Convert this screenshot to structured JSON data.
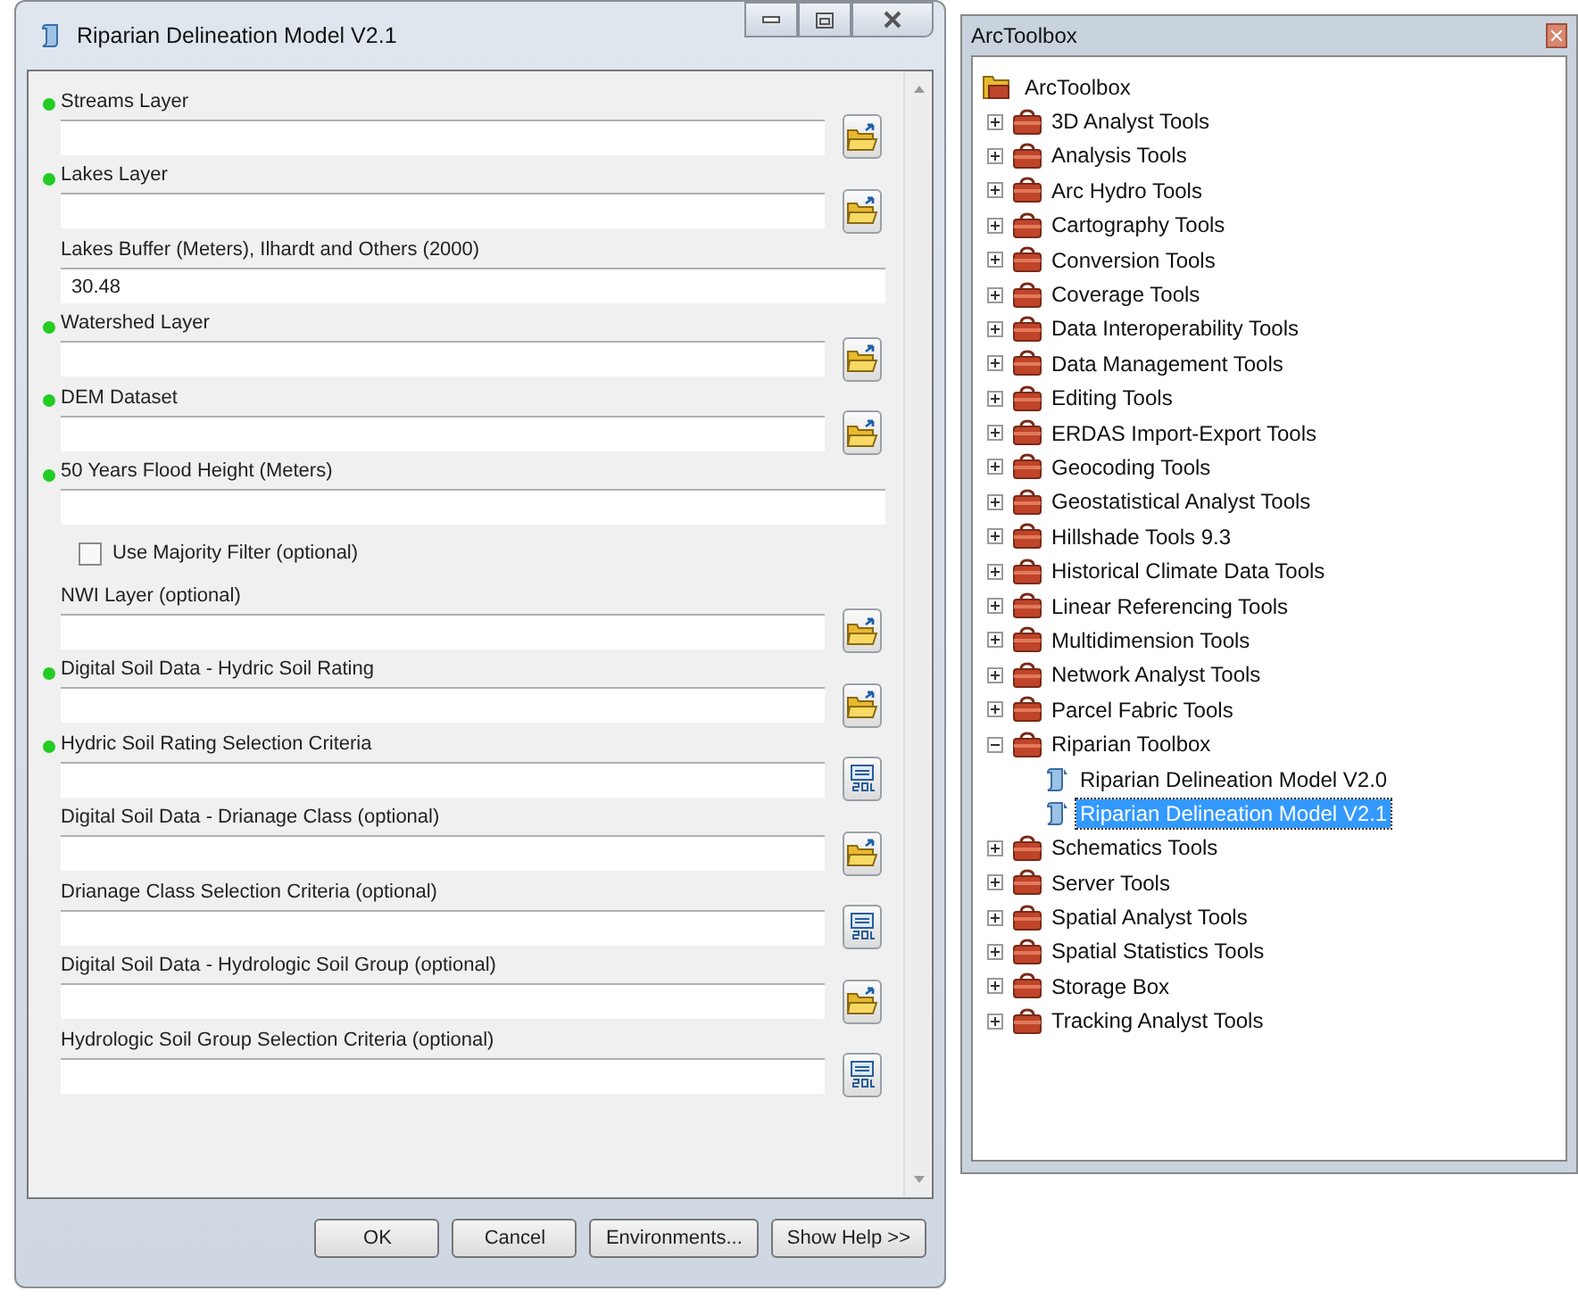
{
  "window": {
    "title": "Riparian Delineation Model V2.1"
  },
  "params": [
    {
      "label": "Streams Layer",
      "required": true,
      "kind": "folder"
    },
    {
      "label": "Lakes Layer",
      "required": true,
      "kind": "folder"
    },
    {
      "label": "Lakes Buffer (Meters), Ilhardt and Others (2000)",
      "required": false,
      "kind": "plain",
      "value": "30.48"
    },
    {
      "label": "Watershed Layer",
      "required": true,
      "kind": "folder"
    },
    {
      "label": "DEM Dataset",
      "required": true,
      "kind": "folder"
    },
    {
      "label": "50 Years Flood Height (Meters)",
      "required": true,
      "kind": "plain"
    },
    {
      "label": "Use Majority Filter (optional)",
      "required": false,
      "kind": "checkbox",
      "checked": false
    },
    {
      "label": "NWI Layer (optional)",
      "required": false,
      "kind": "folder"
    },
    {
      "label": "Digital Soil Data - Hydric Soil Rating",
      "required": true,
      "kind": "folder"
    },
    {
      "label": "Hydric Soil Rating Selection Criteria",
      "required": true,
      "kind": "sql"
    },
    {
      "label": "Digital Soil Data - Drianage Class (optional)",
      "required": false,
      "kind": "folder"
    },
    {
      "label": "Drianage Class Selection Criteria (optional)",
      "required": false,
      "kind": "sql"
    },
    {
      "label": "Digital Soil Data - Hydrologic Soil Group (optional)",
      "required": false,
      "kind": "folder"
    },
    {
      "label": "Hydrologic Soil Group Selection Criteria (optional)",
      "required": false,
      "kind": "sql"
    }
  ],
  "buttons": [
    "OK",
    "Cancel",
    "Environments...",
    "Show Help >>"
  ],
  "toolbox": {
    "title": "ArcToolbox",
    "tree": {
      "label": "ArcToolbox",
      "selected": false,
      "children": [
        {
          "label": "3D Analyst Tools",
          "kind": "toolbox",
          "expanded": false,
          "selected": false
        },
        {
          "label": "Analysis Tools",
          "kind": "toolbox",
          "expanded": false,
          "selected": false
        },
        {
          "label": "Arc Hydro Tools",
          "kind": "toolbox",
          "expanded": false,
          "selected": false
        },
        {
          "label": "Cartography Tools",
          "kind": "toolbox",
          "expanded": false,
          "selected": false
        },
        {
          "label": "Conversion Tools",
          "kind": "toolbox",
          "expanded": false,
          "selected": false
        },
        {
          "label": "Coverage Tools",
          "kind": "toolbox",
          "expanded": false,
          "selected": false
        },
        {
          "label": "Data Interoperability Tools",
          "kind": "toolbox",
          "expanded": false,
          "selected": false
        },
        {
          "label": "Data Management Tools",
          "kind": "toolbox",
          "expanded": false,
          "selected": false
        },
        {
          "label": "Editing Tools",
          "kind": "toolbox",
          "expanded": false,
          "selected": false
        },
        {
          "label": "ERDAS Import-Export Tools",
          "kind": "toolbox",
          "expanded": false,
          "selected": false
        },
        {
          "label": "Geocoding Tools",
          "kind": "toolbox",
          "expanded": false,
          "selected": false
        },
        {
          "label": "Geostatistical Analyst Tools",
          "kind": "toolbox",
          "expanded": false,
          "selected": false
        },
        {
          "label": "Hillshade Tools 9.3",
          "kind": "toolbox",
          "expanded": false,
          "selected": false
        },
        {
          "label": "Historical Climate Data Tools",
          "kind": "toolbox",
          "expanded": false,
          "selected": false
        },
        {
          "label": "Linear Referencing Tools",
          "kind": "toolbox",
          "expanded": false,
          "selected": false
        },
        {
          "label": "Multidimension Tools",
          "kind": "toolbox",
          "expanded": false,
          "selected": false
        },
        {
          "label": "Network Analyst Tools",
          "kind": "toolbox",
          "expanded": false,
          "selected": false
        },
        {
          "label": "Parcel Fabric Tools",
          "kind": "toolbox",
          "expanded": false,
          "selected": false
        },
        {
          "label": "Riparian Toolbox",
          "kind": "toolbox",
          "expanded": true,
          "selected": false,
          "children": [
            {
              "label": "Riparian Delineation Model V2.0",
              "kind": "tool",
              "selected": false
            },
            {
              "label": "Riparian Delineation Model V2.1",
              "kind": "tool",
              "selected": true
            }
          ]
        },
        {
          "label": "Schematics Tools",
          "kind": "toolbox",
          "expanded": false,
          "selected": false
        },
        {
          "label": "Server Tools",
          "kind": "toolbox",
          "expanded": false,
          "selected": false
        },
        {
          "label": "Spatial Analyst Tools",
          "kind": "toolbox",
          "expanded": false,
          "selected": false
        },
        {
          "label": "Spatial Statistics Tools",
          "kind": "toolbox",
          "expanded": false,
          "selected": false
        },
        {
          "label": "Storage Box",
          "kind": "toolbox",
          "expanded": false,
          "selected": false
        },
        {
          "label": "Tracking Analyst Tools",
          "kind": "toolbox",
          "expanded": false,
          "selected": false
        }
      ]
    }
  }
}
